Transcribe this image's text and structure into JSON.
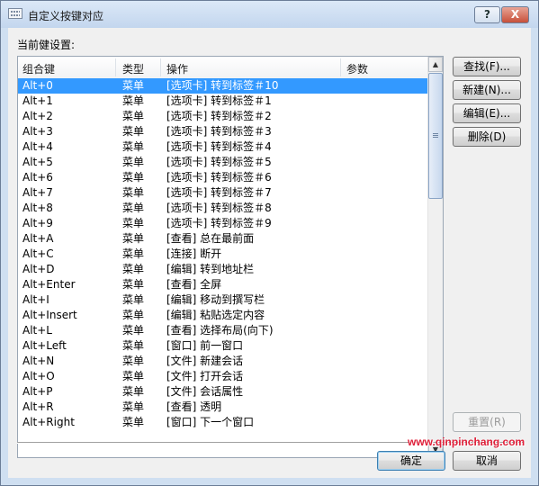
{
  "window": {
    "title": "自定义按键对应"
  },
  "caption_buttons": {
    "help": "?",
    "close": "X"
  },
  "section_label": "当前健设置:",
  "columns": {
    "combo": "组合键",
    "type": "类型",
    "action": "操作",
    "param": "参数"
  },
  "rows": [
    {
      "key": "Alt+0",
      "type": "菜单",
      "action": "[选项卡] 转到标签＃10"
    },
    {
      "key": "Alt+1",
      "type": "菜单",
      "action": "[选项卡] 转到标签＃1"
    },
    {
      "key": "Alt+2",
      "type": "菜单",
      "action": "[选项卡] 转到标签＃2"
    },
    {
      "key": "Alt+3",
      "type": "菜单",
      "action": "[选项卡] 转到标签＃3"
    },
    {
      "key": "Alt+4",
      "type": "菜单",
      "action": "[选项卡] 转到标签＃4"
    },
    {
      "key": "Alt+5",
      "type": "菜单",
      "action": "[选项卡] 转到标签＃5"
    },
    {
      "key": "Alt+6",
      "type": "菜单",
      "action": "[选项卡] 转到标签＃6"
    },
    {
      "key": "Alt+7",
      "type": "菜单",
      "action": "[选项卡] 转到标签＃7"
    },
    {
      "key": "Alt+8",
      "type": "菜单",
      "action": "[选项卡] 转到标签＃8"
    },
    {
      "key": "Alt+9",
      "type": "菜单",
      "action": "[选项卡] 转到标签＃9"
    },
    {
      "key": "Alt+A",
      "type": "菜单",
      "action": "[查看] 总在最前面"
    },
    {
      "key": "Alt+C",
      "type": "菜单",
      "action": "[连接] 断开"
    },
    {
      "key": "Alt+D",
      "type": "菜单",
      "action": "[编辑] 转到地址栏"
    },
    {
      "key": "Alt+Enter",
      "type": "菜单",
      "action": "[查看] 全屏"
    },
    {
      "key": "Alt+I",
      "type": "菜单",
      "action": "[编辑] 移动到撰写栏"
    },
    {
      "key": "Alt+Insert",
      "type": "菜单",
      "action": "[编辑] 粘贴选定内容"
    },
    {
      "key": "Alt+L",
      "type": "菜单",
      "action": "[查看] 选择布局(向下)"
    },
    {
      "key": "Alt+Left",
      "type": "菜单",
      "action": "[窗口] 前一窗口"
    },
    {
      "key": "Alt+N",
      "type": "菜单",
      "action": "[文件] 新建会话"
    },
    {
      "key": "Alt+O",
      "type": "菜单",
      "action": "[文件] 打开会话"
    },
    {
      "key": "Alt+P",
      "type": "菜单",
      "action": "[文件] 会话属性"
    },
    {
      "key": "Alt+R",
      "type": "菜单",
      "action": "[查看] 透明"
    },
    {
      "key": "Alt+Right",
      "type": "菜单",
      "action": "[窗口] 下一个窗口"
    }
  ],
  "selected_row": 0,
  "buttons": {
    "find": "查找(F)...",
    "new": "新建(N)...",
    "edit": "编辑(E)...",
    "delete": "删除(D)",
    "reset": "重置(R)",
    "ok": "确定",
    "cancel": "取消"
  },
  "icons": {
    "window": "keyboard-icon",
    "scroll_up": "▲",
    "scroll_down": "▼"
  },
  "watermark": "www.qinpinchang.com",
  "colors": {
    "selection": "#3399ff",
    "titlebar": "#c3d6ee",
    "close": "#c7503a",
    "watermark": "#e0203a"
  }
}
